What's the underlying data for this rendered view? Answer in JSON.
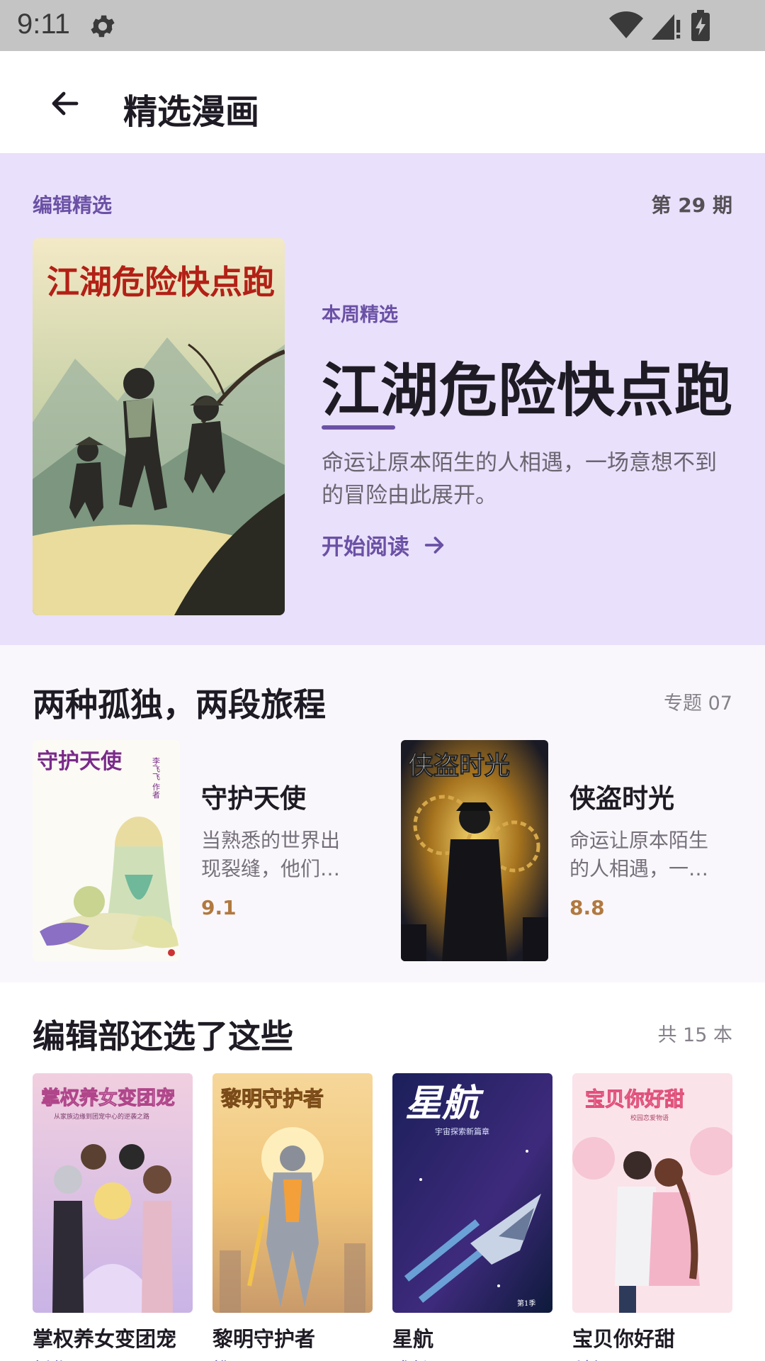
{
  "status_bar": {
    "time": "9:11"
  },
  "app_bar": {
    "title": "精选漫画"
  },
  "featured": {
    "section_label": "编辑精选",
    "issue": "第 29 期",
    "tag": "本周精选",
    "title": "江湖危险快点跑",
    "cover_title": "江湖危险快点跑",
    "description": "命运让原本陌生的人相遇，一场意想不到的冒险由此展开。",
    "read_label": "开始阅读"
  },
  "theme": {
    "title": "两种孤独，两段旅程",
    "meta": "专题 07",
    "items": [
      {
        "name": "守护天使",
        "cover_title": "守护天使",
        "cover_author": "李飞飞 作者",
        "description": "当熟悉的世界出现裂缝，他们…",
        "rating": "9.1"
      },
      {
        "name": "侠盗时光",
        "cover_title": "侠盗时光",
        "description": "命运让原本陌生的人相遇，一…",
        "rating": "8.8"
      }
    ]
  },
  "picks": {
    "title": "编辑部还选了这些",
    "meta": "共 15 本",
    "items": [
      {
        "name": "掌权养女变团宠",
        "genre": "新作",
        "cover_title": "掌权养女变团宠",
        "cover_sub": "从家族边缘到团宠中心的逆袭之路"
      },
      {
        "name": "黎明守护者",
        "genre": "推理",
        "cover_title": "黎明守护者"
      },
      {
        "name": "星航",
        "genre": "成长",
        "cover_title": "星航",
        "cover_sub": "宇宙探索新篇章",
        "cover_vol": "第1季"
      },
      {
        "name": "宝贝你好甜",
        "genre": "科幻",
        "cover_title": "宝贝你好甜",
        "cover_sub": "校园恋爱物语"
      }
    ]
  },
  "colors": {
    "accent": "#6a51a5",
    "featured_bg": "#e9e0fb",
    "rating": "#b1793f",
    "status_bar": "#c4c4c4"
  }
}
